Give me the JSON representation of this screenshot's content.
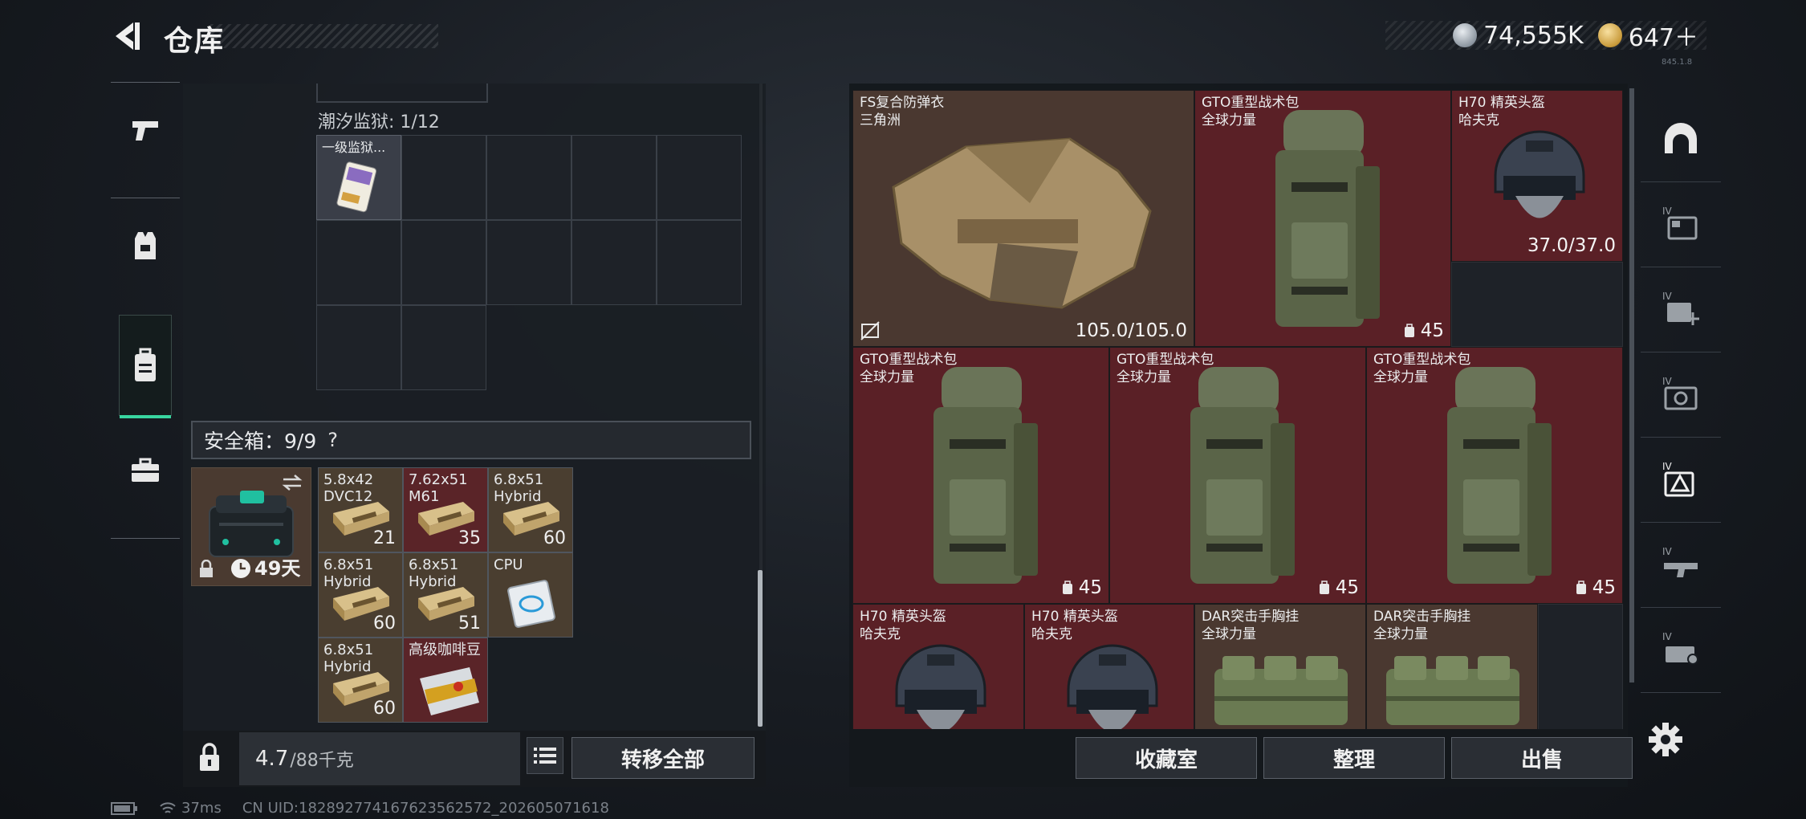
{
  "header": {
    "title": "仓库",
    "currency": [
      {
        "icon": "silver-coin-icon",
        "value": "74,555K"
      },
      {
        "icon": "gold-coin-icon",
        "value": "647＋"
      }
    ],
    "version": "845.1.8"
  },
  "left_sidebar": {
    "items": [
      {
        "name": "weapons",
        "icon": "pistol-icon",
        "active": false
      },
      {
        "name": "armor",
        "icon": "vest-icon",
        "active": false
      },
      {
        "name": "backpacks",
        "icon": "backpack-icon",
        "active": true
      },
      {
        "name": "cases",
        "icon": "briefcase-icon",
        "active": false
      }
    ]
  },
  "container": {
    "label": "潮汐监狱: 1/12",
    "items": [
      {
        "name": "一级监狱...",
        "icon": "keycard-icon"
      }
    ]
  },
  "safebox": {
    "label": "安全箱：9/9",
    "help": "?",
    "days": "49天",
    "items": [
      {
        "name": "5.8x42\nDVC12",
        "count": "21",
        "icon": "ammo-box-icon",
        "bg": "#4a3e30"
      },
      {
        "name": "7.62x51\nM61",
        "count": "35",
        "icon": "ammo-box-icon",
        "bg": "#5a2428"
      },
      {
        "name": "6.8x51\nHybrid",
        "count": "60",
        "icon": "ammo-box-icon",
        "bg": "#4a3e30"
      },
      {
        "name": "6.8x51\nHybrid",
        "count": "60",
        "icon": "ammo-box-icon",
        "bg": "#4a3e30"
      },
      {
        "name": "6.8x51\nHybrid",
        "count": "51",
        "icon": "ammo-box-icon",
        "bg": "#4a3e30"
      },
      {
        "name": "CPU",
        "count": "",
        "icon": "cpu-chip-icon",
        "bg": "#4a3e30"
      },
      {
        "name": "6.8x51\nHybrid",
        "count": "60",
        "icon": "ammo-box-icon",
        "bg": "#4a3e30"
      },
      {
        "name": "高级咖啡豆",
        "count": "",
        "icon": "coffee-bag-icon",
        "bg": "#5a2428"
      }
    ]
  },
  "bottom_bar": {
    "weight_value": "4.7",
    "weight_max": "/88千克",
    "transfer_all": "转移全部"
  },
  "status": {
    "ping": "37ms",
    "uid": "CN UID:18289277416762356257​2_202605071618"
  },
  "stash": {
    "items": [
      {
        "name": "FS复合防弹衣\n三角洲",
        "durability": "105.0/105.0",
        "slots": "",
        "color": "brown",
        "icon": "body-armor-icon",
        "no_mod": true
      },
      {
        "name": "GTO重型战术包\n全球力量",
        "durability": "",
        "slots": "45",
        "color": "red",
        "icon": "tactical-backpack-icon"
      },
      {
        "name": "H70 精英头盔\n哈夫克",
        "durability": "37.0/37.0",
        "slots": "",
        "color": "red",
        "icon": "helmet-icon"
      },
      {
        "name": "GTO重型战术包\n全球力量",
        "durability": "",
        "slots": "45",
        "color": "red",
        "icon": "tactical-backpack-icon"
      },
      {
        "name": "GTO重型战术包\n全球力量",
        "durability": "",
        "slots": "45",
        "color": "red",
        "icon": "tactical-backpack-icon"
      },
      {
        "name": "GTO重型战术包\n全球力量",
        "durability": "",
        "slots": "45",
        "color": "red",
        "icon": "tactical-backpack-icon"
      },
      {
        "name": "H70 精英头盔\n哈夫克",
        "durability": "",
        "slots": "",
        "color": "red",
        "icon": "helmet-icon"
      },
      {
        "name": "H70 精英头盔\n哈夫克",
        "durability": "",
        "slots": "",
        "color": "red",
        "icon": "helmet-icon"
      },
      {
        "name": "DAR突击手胸挂\n全球力量",
        "durability": "",
        "slots": "",
        "color": "brown",
        "icon": "chest-rig-icon"
      },
      {
        "name": "DAR突击手胸挂\n全球力量",
        "durability": "",
        "slots": "",
        "color": "brown",
        "icon": "chest-rig-icon"
      }
    ],
    "buttons": {
      "collection": "收藏室",
      "sort": "整理",
      "sell": "出售"
    }
  },
  "right_sidebar": {
    "items": [
      {
        "icon": "helmet-slot-icon",
        "label": ""
      },
      {
        "icon": "stash-page-icon",
        "label": "IV"
      },
      {
        "icon": "stash-add-icon",
        "label": "IV"
      },
      {
        "icon": "stash-camera-icon",
        "label": "IV"
      },
      {
        "icon": "stash-armor-icon",
        "label": "IV",
        "active": true
      },
      {
        "icon": "stash-weapon-icon",
        "label": "IV"
      },
      {
        "icon": "stash-misc-icon",
        "label": "IV"
      }
    ],
    "settings_icon": "gear-icon"
  }
}
